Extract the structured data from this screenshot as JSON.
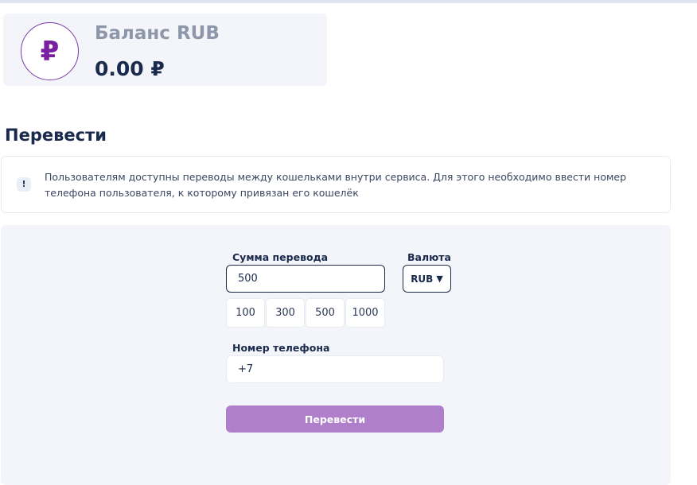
{
  "balance": {
    "currency_symbol": "₽",
    "title": "Баланс RUB",
    "amount": "0.00 ₽"
  },
  "transfer": {
    "section_title": "Перевести",
    "info_icon": "!",
    "info_text": "Пользователям доступны переводы между кошельками внутри сервиса. Для этого необходимо ввести номер телефона пользователя, к которому привязан его кошелёк",
    "amount_label": "Сумма перевода",
    "amount_value": "500",
    "currency_label": "Валюта",
    "currency_value": "RUB",
    "caret": "▼",
    "presets": [
      "100",
      "300",
      "500",
      "1000"
    ],
    "phone_label": "Номер телефона",
    "phone_value": "+7",
    "submit_label": "Перевести"
  },
  "colors": {
    "accent": "#b07fcc",
    "brand_purple": "#7a1fa0",
    "panel_bg": "#f3f5fa",
    "text_dark": "#1a2a4d"
  }
}
